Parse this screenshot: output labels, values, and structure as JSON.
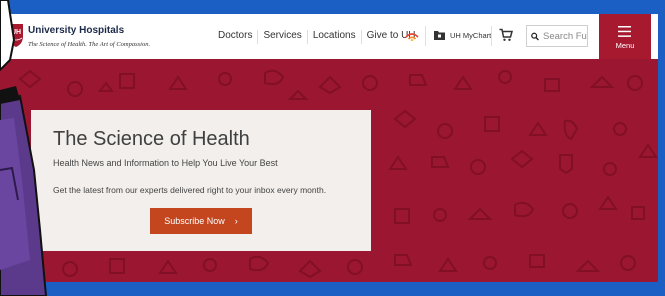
{
  "header": {
    "logo_badge": "UH",
    "logo_title": "University Hospitals",
    "logo_tagline": "The Science of Health. The Art of Compassion.",
    "nav": [
      {
        "label": "Doctors"
      },
      {
        "label": "Services"
      },
      {
        "label": "Locations"
      },
      {
        "label": "Give to UH"
      }
    ],
    "mychart_label": "UH MyChart",
    "search_placeholder": "Search Full",
    "menu_label": "Menu"
  },
  "hero": {
    "title": "The Science of Health",
    "subtitle": "Health News and Information to Help You Live Your Best",
    "text": "Get the latest from our experts delivered right to your inbox every month.",
    "button_label": "Subscribe Now",
    "button_chevron": "›"
  },
  "colors": {
    "brand_red": "#a6192e",
    "hero_bg": "#9b1631",
    "button_orange": "#c4461f",
    "frame_blue": "#1b5fc4"
  }
}
